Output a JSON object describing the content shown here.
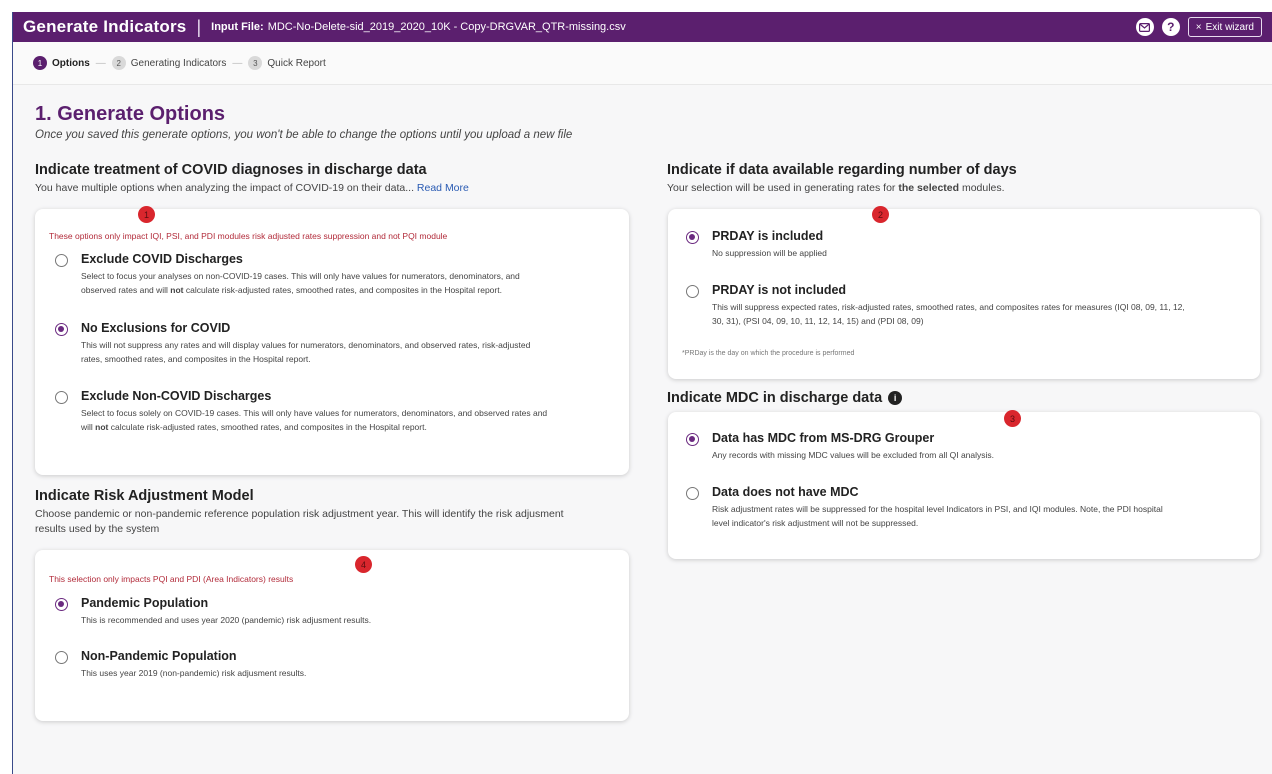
{
  "header": {
    "title": "Generate Indicators",
    "separator": "|",
    "file_label": "Input File:",
    "file_name": "MDC-No-Delete-sid_2019_2020_10K - Copy-DRGVAR_QTR-missing.csv",
    "mail_icon": "mail-icon",
    "help_icon_glyph": "?",
    "exit_icon_glyph": "×",
    "exit_label": "Exit wizard"
  },
  "stepper": {
    "separator": "—",
    "steps": [
      {
        "num": "1",
        "label": "Options",
        "active": true
      },
      {
        "num": "2",
        "label": "Generating Indicators",
        "active": false
      },
      {
        "num": "3",
        "label": "Quick Report",
        "active": false
      }
    ]
  },
  "page": {
    "title": "1. Generate Options",
    "subtitle": "Once you saved this generate options, you won't be able to change the options until you upload a new file"
  },
  "covid": {
    "title": "Indicate treatment of COVID diagnoses in discharge data",
    "subtitle": "You have multiple options when analyzing the impact of COVID-19 on their data...",
    "read_more": "Read More",
    "badge": "1",
    "note": "These options only impact IQI, PSI, and PDI modules risk adjusted rates suppression and not PQI module",
    "options": [
      {
        "title": "Exclude COVID Discharges",
        "desc_a": "Select to focus your analyses on non-COVID-19 cases. This will only have values for numerators, denominators, and",
        "desc_b1": "observed rates and will ",
        "desc_bold": "not",
        "desc_b2": " calculate risk-adjusted rates, smoothed rates, and composites in the Hospital report.",
        "selected": false
      },
      {
        "title": "No Exclusions for COVID",
        "desc_a": "This will not suppress any rates and will display values for numerators, denominators, and observed rates, risk-adjusted",
        "desc_b": "rates, smoothed rates, and composites in the Hospital report.",
        "selected": true
      },
      {
        "title": "Exclude Non-COVID Discharges",
        "desc_a": "Select to focus solely on COVID-19 cases. This will only have values for numerators, denominators, and observed rates and",
        "desc_b1": "will ",
        "desc_bold": "not",
        "desc_b2": " calculate risk-adjusted rates, smoothed rates, and composites in the Hospital report.",
        "selected": false
      }
    ]
  },
  "risk": {
    "title": "Indicate Risk Adjustment Model",
    "subtitle_a": "Choose pandemic or non-pandemic reference population risk adjustment year. This will identify the risk adjusment",
    "subtitle_b": "results used by the system",
    "badge": "4",
    "note": "This selection only impacts PQI and PDI (Area Indicators) results",
    "options": [
      {
        "title": "Pandemic Population",
        "desc": "This is recommended and uses year 2020 (pandemic) risk adjusment results.",
        "selected": true
      },
      {
        "title": "Non-Pandemic Population",
        "desc": "This uses year 2019 (non-pandemic) risk adjusment results.",
        "selected": false
      }
    ]
  },
  "days": {
    "title": "Indicate if data available regarding number of days",
    "subtitle_a": "Your selection will be used in generating rates for ",
    "subtitle_bold": "the selected",
    "subtitle_b": " modules.",
    "badge": "2",
    "options": [
      {
        "title": "PRDAY is included",
        "desc_a": "No suppression will be applied",
        "selected": true
      },
      {
        "title": "PRDAY is not included",
        "desc_a": "This will suppress expected rates, risk-adjusted rates, smoothed rates, and composites rates for measures (IQI 08, 09, 11, 12,",
        "desc_b": "30, 31), (PSI 04, 09, 10, 11, 12, 14, 15) and (PDI 08, 09)",
        "selected": false
      }
    ],
    "footnote": "*PRDay is the day on which the procedure is performed"
  },
  "mdc": {
    "title": "Indicate MDC in discharge data",
    "info_glyph": "i",
    "badge": "3",
    "options": [
      {
        "title": "Data has MDC from MS-DRG Grouper",
        "desc_a": "Any records with missing MDC values will be excluded from all QI analysis.",
        "selected": true
      },
      {
        "title": "Data does not have MDC",
        "desc_a": "Risk adjustment rates will be suppressed for the hospital level Indicators in PSI, and IQI modules. Note, the PDI hospital",
        "desc_b": "level indicator's risk adjustment will not be suppressed.",
        "selected": false
      }
    ]
  }
}
